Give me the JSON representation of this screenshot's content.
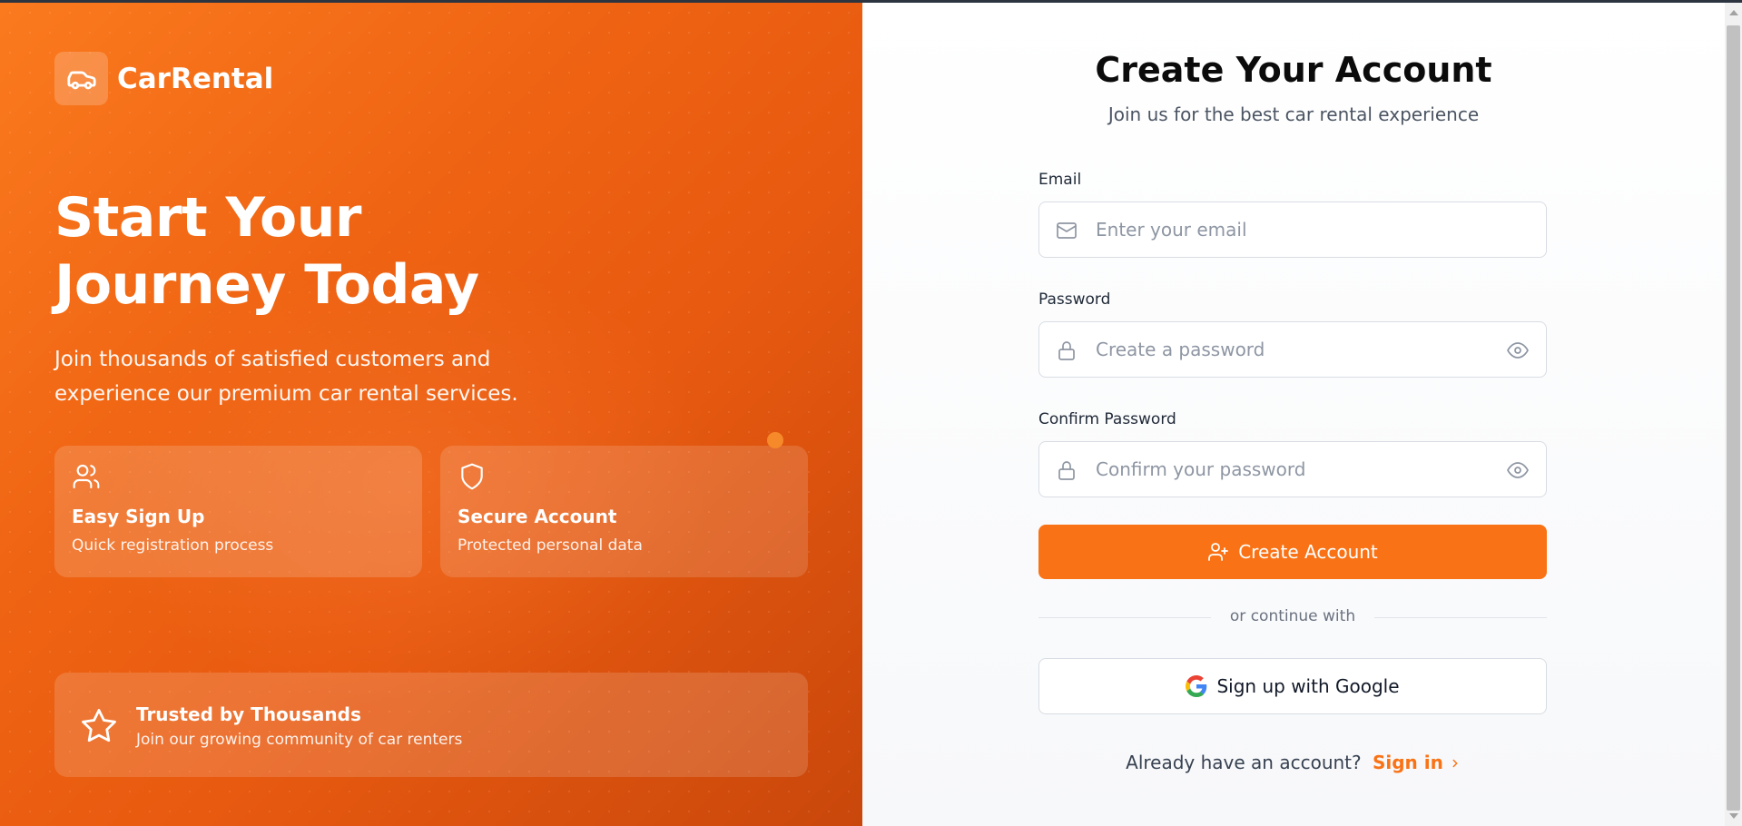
{
  "brand": {
    "name": "CarRental",
    "icon": "car-icon",
    "accent": "#f97316"
  },
  "hero": {
    "title_line1": "Start Your",
    "title_line2": "Journey Today",
    "subtitle_line1": "Join thousands of satisfied customers and",
    "subtitle_line2": "experience our premium car rental services."
  },
  "features": [
    {
      "icon": "users-icon",
      "title": "Easy Sign Up",
      "subtitle": "Quick registration process"
    },
    {
      "icon": "shield-icon",
      "title": "Secure Account",
      "subtitle": "Protected personal data"
    }
  ],
  "trusted": {
    "icon": "star-icon",
    "title": "Trusted by Thousands",
    "subtitle": "Join our growing community of car renters"
  },
  "form": {
    "title": "Create Your Account",
    "subtitle": "Join us for the best car rental experience",
    "email": {
      "label": "Email",
      "placeholder": "Enter your email",
      "value": "",
      "icon": "mail-icon"
    },
    "password": {
      "label": "Password",
      "placeholder": "Create a password",
      "value": "",
      "icon": "lock-icon"
    },
    "confirm": {
      "label": "Confirm Password",
      "placeholder": "Confirm your password",
      "value": "",
      "icon": "lock-icon"
    },
    "submit_label": "Create Account",
    "divider_text": "or continue with",
    "google_label": "Sign up with Google",
    "signin_prompt": "Already have an account?",
    "signin_link": "Sign in"
  }
}
